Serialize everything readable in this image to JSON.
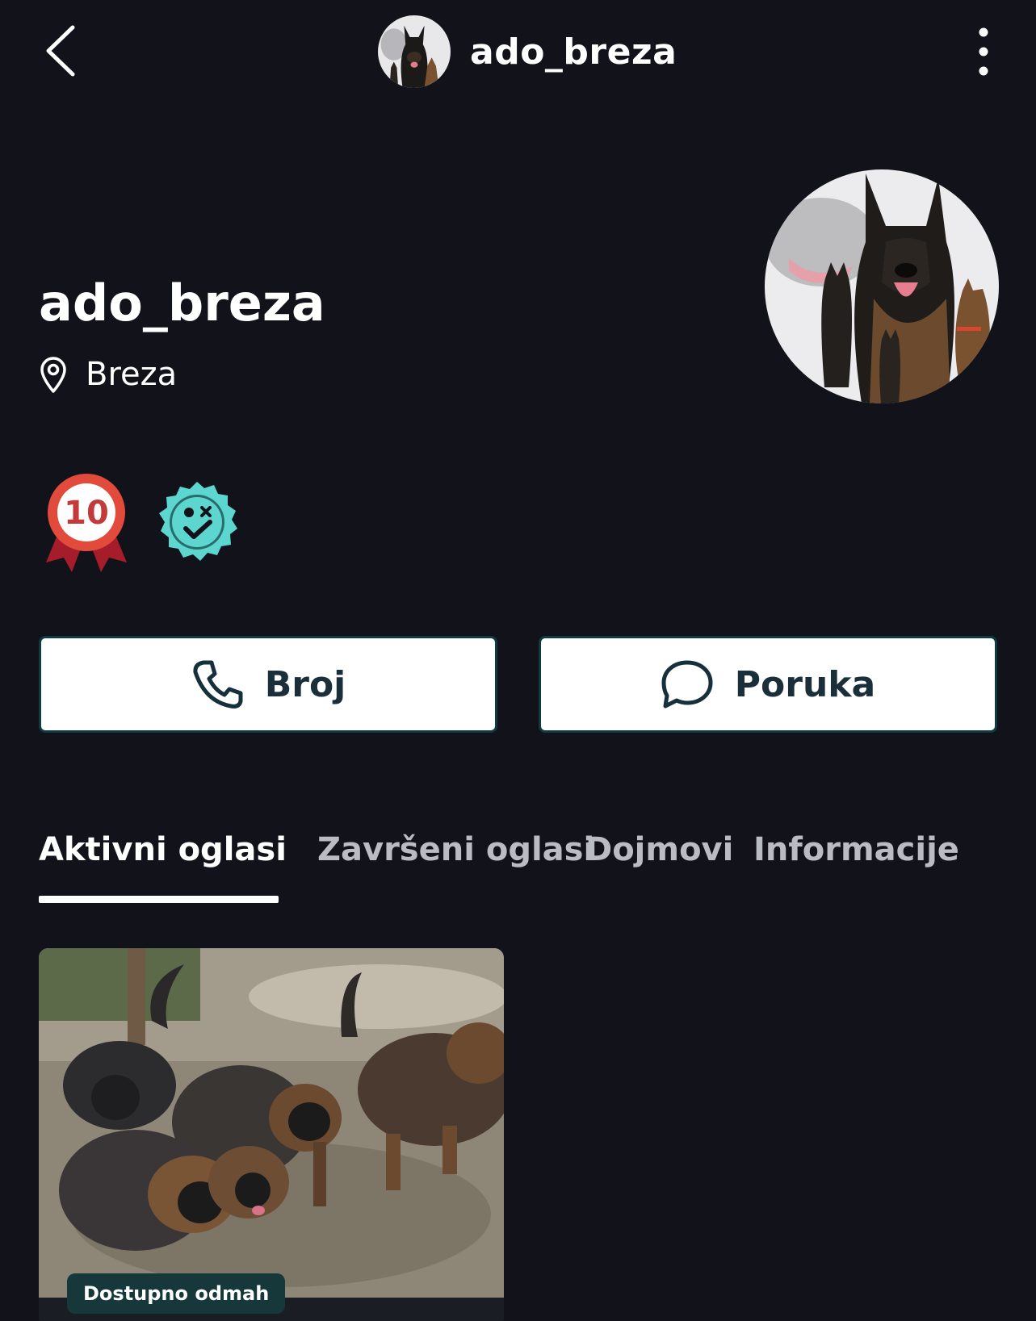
{
  "topbar": {
    "username": "ado_breza",
    "back_icon": "chevron-left-icon",
    "more_icon": "more-vertical-icon"
  },
  "profile": {
    "name": "ado_breza",
    "location": "Breza",
    "location_icon": "map-pin-icon"
  },
  "badges": {
    "count_badge_text": "10",
    "count_badge_icon": "award-ribbon-icon",
    "verified_icon": "verified-seal-icon",
    "colors": {
      "award": "#e24a3b",
      "verified": "#5dd6cf"
    }
  },
  "actions": {
    "call_label": "Broj",
    "call_icon": "phone-icon",
    "message_label": "Poruka",
    "message_icon": "chat-bubble-icon"
  },
  "tabs": [
    {
      "label": "Aktivni oglasi",
      "active": true
    },
    {
      "label": "Završeni oglasi",
      "active": false
    },
    {
      "label": "Dojmovi",
      "active": false
    },
    {
      "label": "Informacije",
      "active": false
    }
  ],
  "listing": {
    "badge": "Dostupno odmah"
  },
  "colors": {
    "background": "#12131a",
    "button_border": "#0f3b3e",
    "badge_bg": "#17383b",
    "tab_inactive": "#b9bcc3"
  }
}
